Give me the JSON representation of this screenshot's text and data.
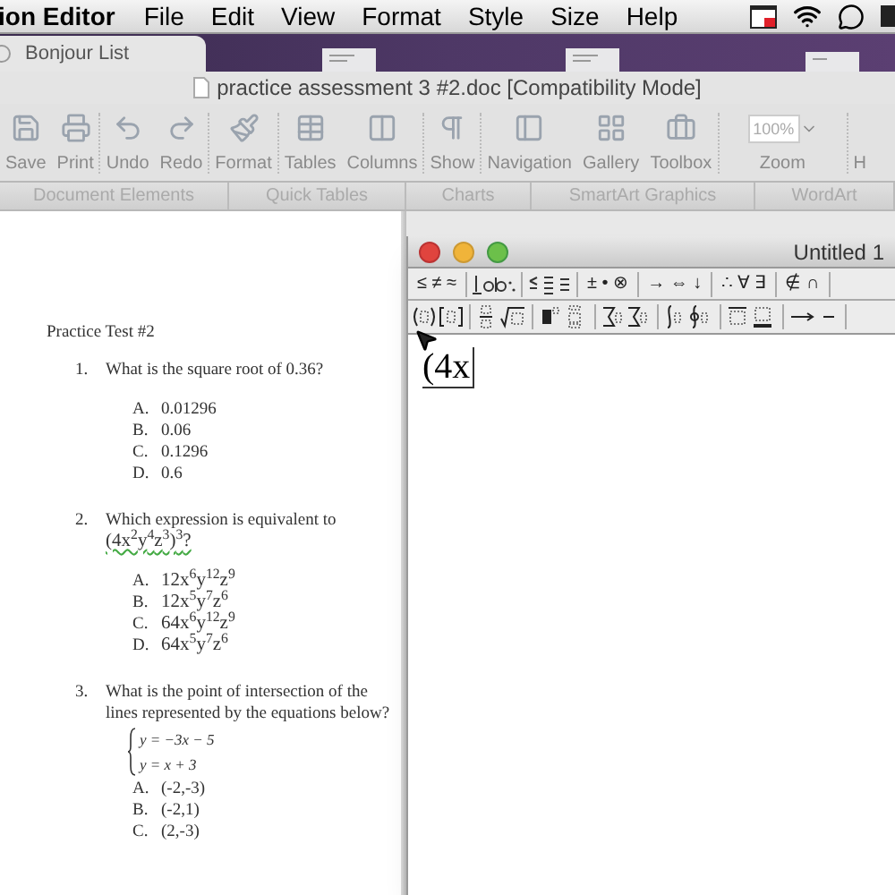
{
  "menu_bar": {
    "app_name": "ion Editor",
    "items": [
      "File",
      "Edit",
      "View",
      "Format",
      "Style",
      "Size",
      "Help"
    ]
  },
  "desktop": {
    "tab": "Bonjour List"
  },
  "word_window": {
    "title": "practice assessment 3 #2.doc [Compatibility Mode]",
    "toolbar": [
      {
        "kind": "save",
        "label": "Save"
      },
      {
        "kind": "print",
        "label": "Print"
      },
      {
        "kind": "undo",
        "label": "Undo"
      },
      {
        "kind": "redo",
        "label": "Redo"
      },
      {
        "kind": "format",
        "label": "Format"
      },
      {
        "kind": "tables",
        "label": "Tables"
      },
      {
        "kind": "columns",
        "label": "Columns"
      },
      {
        "kind": "show",
        "label": "Show"
      },
      {
        "kind": "navigation",
        "label": "Navigation"
      },
      {
        "kind": "gallery",
        "label": "Gallery"
      },
      {
        "kind": "toolbox",
        "label": "Toolbox"
      },
      {
        "kind": "zoom",
        "label": "Zoom",
        "value": "100%"
      },
      {
        "kind": "cut",
        "label": "H"
      }
    ],
    "ribbon_tabs": [
      "Document Elements",
      "Quick Tables",
      "Charts",
      "SmartArt Graphics",
      "WordArt"
    ]
  },
  "document": {
    "heading": "Practice Test #2",
    "questions": [
      {
        "number": "1.",
        "text": "What is the square root of 0.36?",
        "choices": [
          {
            "letter": "A.",
            "text": "0.01296"
          },
          {
            "letter": "B.",
            "text": "0.06"
          },
          {
            "letter": "C.",
            "text": "0.1296"
          },
          {
            "letter": "D.",
            "text": "0.6"
          }
        ]
      },
      {
        "number": "2.",
        "text": "Which expression is equivalent to",
        "expression": "(4x$^{2}$y$^{4}$z$^{3}$)$^{3}$?",
        "choices": [
          {
            "letter": "A.",
            "text": "12x$^{6}$y$^{12}$z$^{9}$"
          },
          {
            "letter": "B.",
            "text": "12x$^{5}$y$^{7}$z$^{6}$"
          },
          {
            "letter": "C.",
            "text": "64x$^{6}$y$^{12}$z$^{9}$"
          },
          {
            "letter": "D.",
            "text": "64x$^{5}$y$^{7}$z$^{6}$"
          }
        ]
      },
      {
        "number": "3.",
        "text": "What is the point of intersection of the lines represented by the equations below?",
        "equations": [
          "y = −3x − 5",
          "y = x + 3"
        ],
        "choices": [
          {
            "letter": "A.",
            "text": "(-2,-3)"
          },
          {
            "letter": "B.",
            "text": "(-2,1)"
          },
          {
            "letter": "C.",
            "text": "(2,-3)"
          }
        ]
      }
    ]
  },
  "equation_window": {
    "title": "Untitled 1",
    "symbol_groups": [
      {
        "kind": "text",
        "text": "≤ ≠ ≈"
      },
      {
        "kind": "icon"
      },
      {
        "kind": "icon"
      },
      {
        "kind": "text",
        "text": "± • ⊗"
      },
      {
        "kind": "text",
        "text": "→ ⇔ ↓"
      },
      {
        "kind": "text",
        "text": "∴ ∀ ∃"
      },
      {
        "kind": "text",
        "text": "∉ ∩"
      }
    ],
    "template_groups": [
      {
        "kind": "fence"
      },
      {
        "kind": "fraction"
      },
      {
        "kind": "script"
      },
      {
        "kind": "sum"
      },
      {
        "kind": "integral"
      },
      {
        "kind": "bar"
      },
      {
        "kind": "arrow"
      }
    ],
    "content": "(4x"
  }
}
